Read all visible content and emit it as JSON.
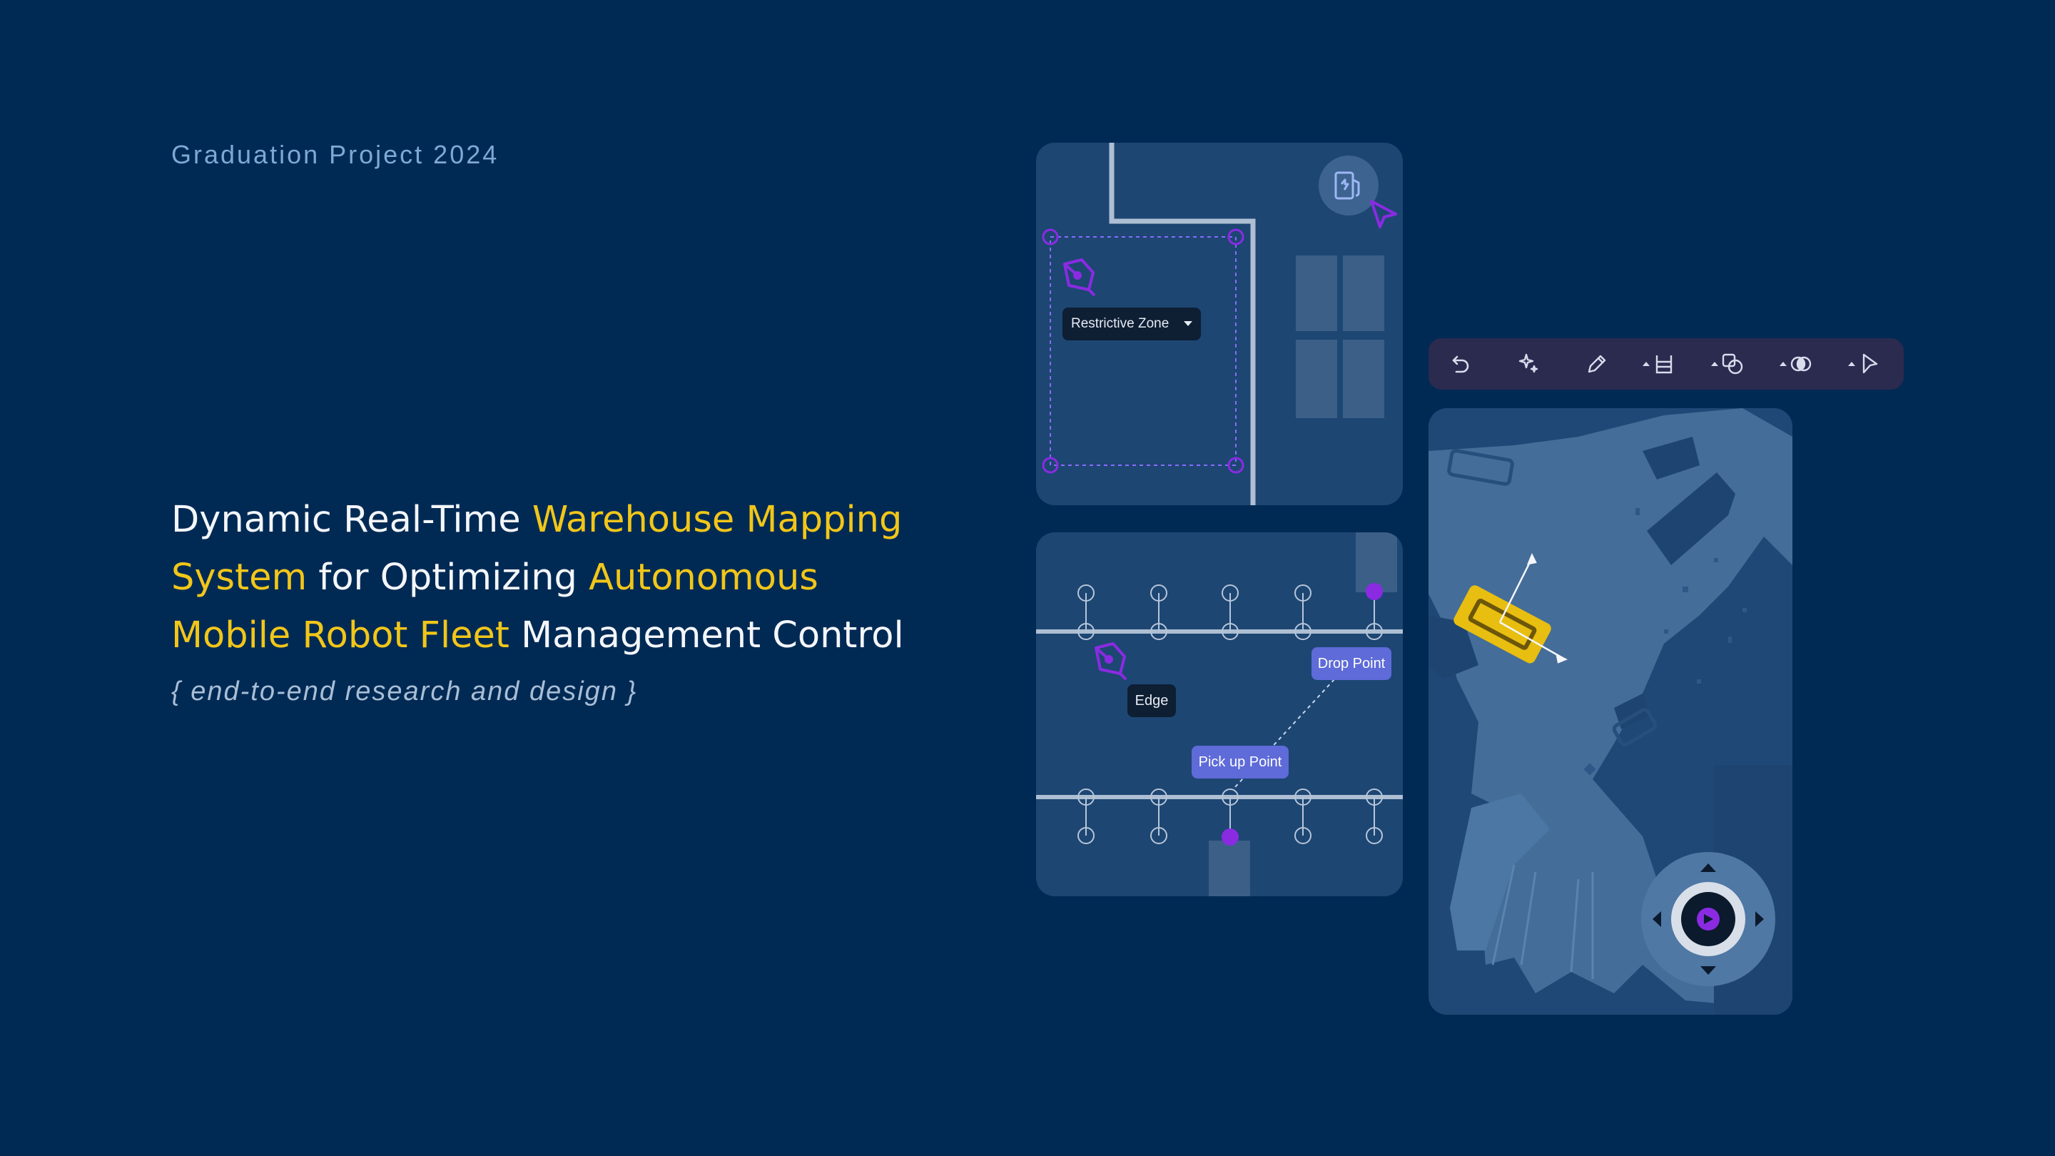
{
  "eyebrow": "Graduation Project 2024",
  "headline": {
    "line1": [
      {
        "text": "Dynamic Real-Time ",
        "highlight": false
      },
      {
        "text": "Warehouse Mapping",
        "highlight": true
      }
    ],
    "line2": [
      {
        "text": "System",
        "highlight": true
      },
      {
        "text": " for Optimizing ",
        "highlight": false
      },
      {
        "text": "Autonomous",
        "highlight": true
      }
    ],
    "line3": [
      {
        "text": "Mobile Robot Fleet",
        "highlight": true
      },
      {
        "text": " Management Control",
        "highlight": false
      }
    ]
  },
  "subtitle": "{ end-to-end research and design }",
  "zone_panel": {
    "dropdown_label": "Restrictive Zone",
    "icons": [
      "charging-station-icon",
      "cursor-arrow-icon",
      "pen-tool-icon"
    ]
  },
  "graph_panel": {
    "drop_label": "Drop Point",
    "pickup_label": "Pick up Point",
    "edge_label": "Edge"
  },
  "toolbar": {
    "tools": [
      "undo-icon",
      "magic-wand-icon",
      "pencil-icon",
      "shelf-icon",
      "shapes-icon",
      "blend-icon",
      "pointer-icon"
    ]
  },
  "map_panel": {
    "icons": [
      "robot-icon",
      "joystick-icon",
      "play-icon"
    ]
  },
  "colors": {
    "background": "#002A54",
    "panel": "#1D4673",
    "highlight": "#F2C619",
    "accent_purple": "#8A2BE2",
    "tag_blue": "#5E6BD8",
    "toolbar": "#2B2A4F"
  }
}
